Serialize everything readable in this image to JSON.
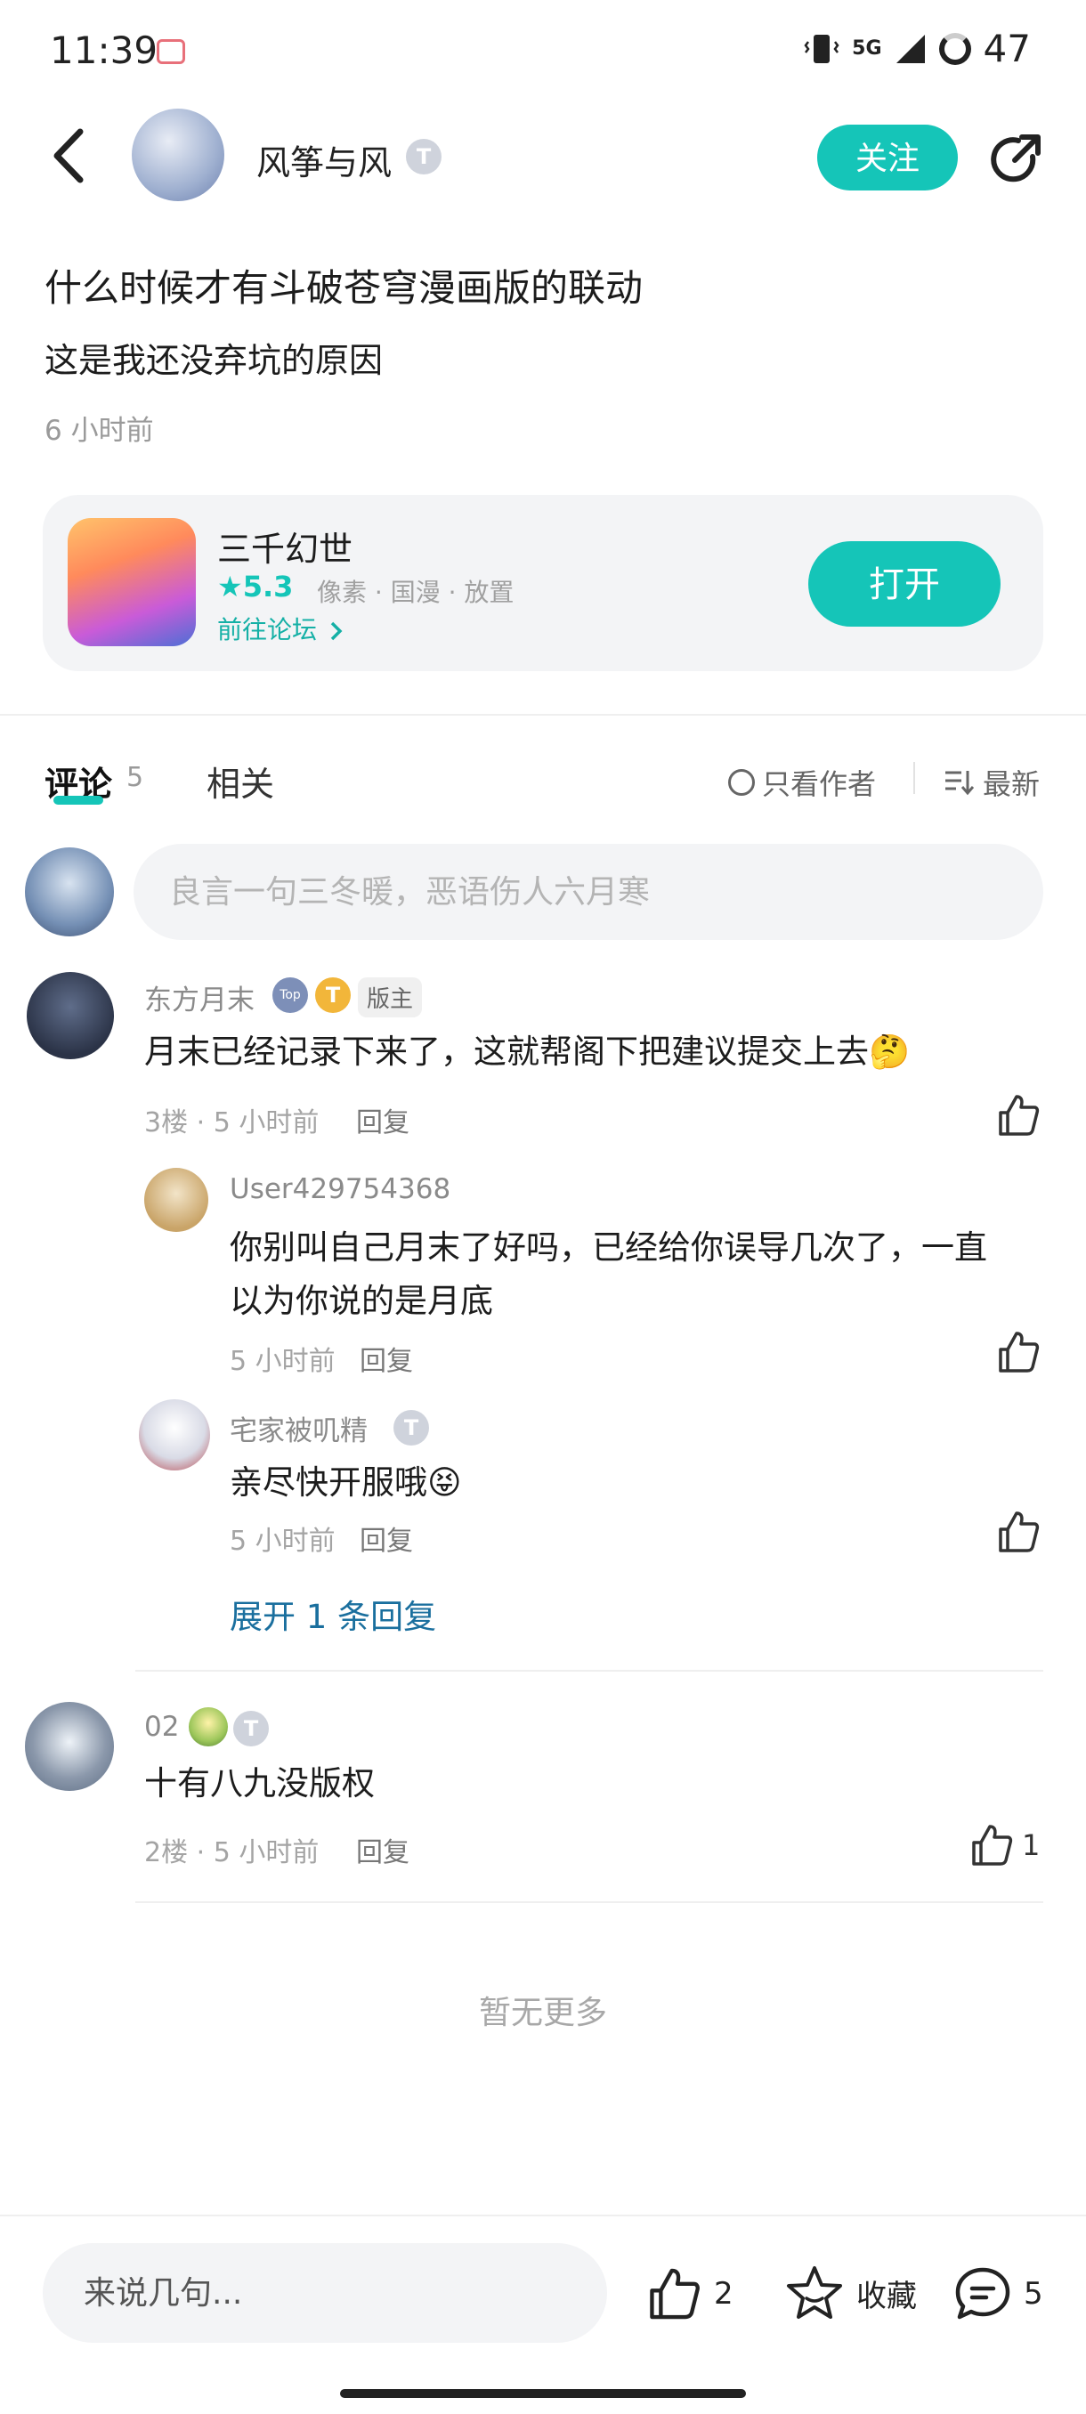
{
  "status_bar": {
    "time": "11:39",
    "network": "5G",
    "battery": "47"
  },
  "header": {
    "author_name": "风筝与风",
    "level_badge": "T",
    "follow_label": "关注"
  },
  "post": {
    "title": "什么时候才有斗破苍穹漫画版的联动",
    "body": "这是我还没弃坑的原因",
    "time": "6 小时前"
  },
  "game_card": {
    "name": "三千幻世",
    "rating": "★5.3",
    "tags": "像素 · 国漫 · 放置",
    "forum_link": "前往论坛",
    "open_label": "打开"
  },
  "tabs": {
    "comments_label": "评论",
    "comments_count": "5",
    "related_label": "相关",
    "only_author_label": "只看作者",
    "sort_label": "最新"
  },
  "comment_input": {
    "placeholder": "良言一句三冬暖，恶语伤人六月寒"
  },
  "comments": [
    {
      "name": "东方月末",
      "role": "版主",
      "text": "月末已经记录下来了，这就帮阁下把建议提交上去🤔",
      "floor": "3楼 · 5 小时前",
      "reply_label": "回复",
      "replies": [
        {
          "name": "User429754368",
          "text_line1": "你别叫自己月末了好吗，已经给你误导几次了，一直",
          "text_line2": "以为你说的是月底",
          "time": "5 小时前",
          "reply_label": "回复"
        },
        {
          "name": "宅家被叽精",
          "text": "亲尽快开服哦😝",
          "time": "5 小时前",
          "reply_label": "回复"
        }
      ],
      "expand_label": "展开 1 条回复"
    },
    {
      "name": "02",
      "text": "十有八九没版权",
      "floor": "2楼 · 5 小时前",
      "reply_label": "回复",
      "likes": "1"
    }
  ],
  "footer": {
    "no_more": "暂无更多"
  },
  "bottom_bar": {
    "input_placeholder": "来说几句...",
    "like_count": "2",
    "favorite_label": "收藏",
    "comment_count": "5"
  },
  "colors": {
    "accent": "#15c5b8",
    "link": "#1a6f9e"
  }
}
